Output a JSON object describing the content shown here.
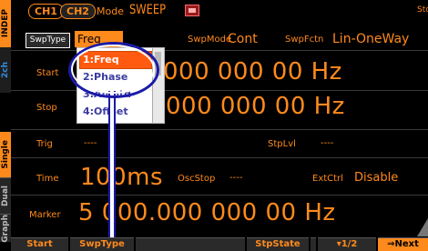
{
  "side_tabs": {
    "indep": "INDEP",
    "ch2": "2ch",
    "single": "Single",
    "dual": "Dual",
    "graph": "Graph"
  },
  "top_bar": {
    "ch1": "CH1",
    "ch2": "CH2",
    "mode_label": "Mode",
    "mode_value": "SWEEP",
    "stop_status": "Stop"
  },
  "params": {
    "swptype_label": "SwpType",
    "swptype_value": "Freq",
    "swpmode_label": "SwpMode",
    "swpmode_value": "Cont",
    "swpfctn_label": "SwpFctn",
    "swpfctn_value": "Lin-OneWay",
    "start_label": "Start",
    "start_value": "000 000 00 Hz",
    "stop_label": "Stop",
    "stop_value": "000 000 00 Hz",
    "trig_label": "Trig",
    "trig_value": "----",
    "stplvl_label": "StpLvl",
    "stplvl_value": "----",
    "time_label": "Time",
    "time_value": "100ms",
    "oscstop_label": "OscStop",
    "oscstop_value": "----",
    "extctrl_label": "ExtCtrl",
    "extctrl_value": "Disable",
    "marker_label": "Marker",
    "marker_value": "5 000.000 000 00 Hz"
  },
  "dropdown": {
    "items": [
      "1:Freq",
      "2:Phase",
      "3:Amptd",
      "4:Offset"
    ],
    "selected_index": 0
  },
  "softkeys": [
    "Start",
    "SwpType",
    "",
    "StpState",
    "",
    "▾1/2",
    "⇒Next"
  ],
  "colors": {
    "accent": "#ff8a1c",
    "highlight": "#ff5a10",
    "callout": "#1a1aa8",
    "background": "#000000"
  }
}
